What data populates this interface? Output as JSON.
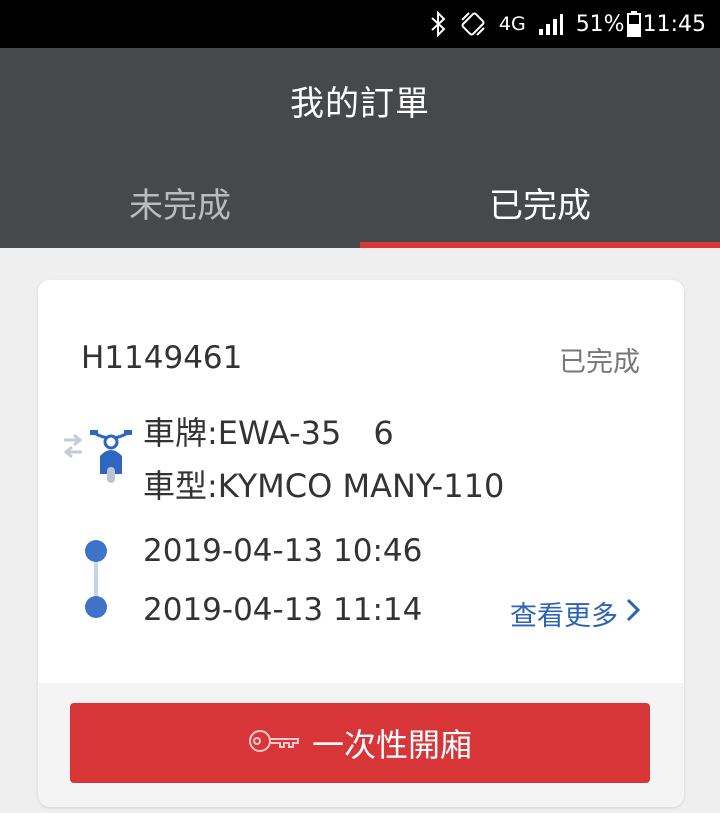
{
  "status_bar": {
    "network": "4G",
    "battery": "51%",
    "time": "11:45"
  },
  "header": {
    "title": "我的訂單",
    "tabs": [
      {
        "label": "未完成",
        "active": false
      },
      {
        "label": "已完成",
        "active": true
      }
    ]
  },
  "order": {
    "id": "H1149461",
    "status": "已完成",
    "plate": "車牌:EWA-35　6",
    "model": "車型:KYMCO MANY-110",
    "start_time": "2019-04-13 10:46",
    "end_time": "2019-04-13 11:14",
    "more_label": "查看更多",
    "unlock_label": "一次性開廂"
  },
  "colors": {
    "accent_red": "#d83539",
    "link_blue": "#2d63b3",
    "header_gray": "#47484a"
  }
}
